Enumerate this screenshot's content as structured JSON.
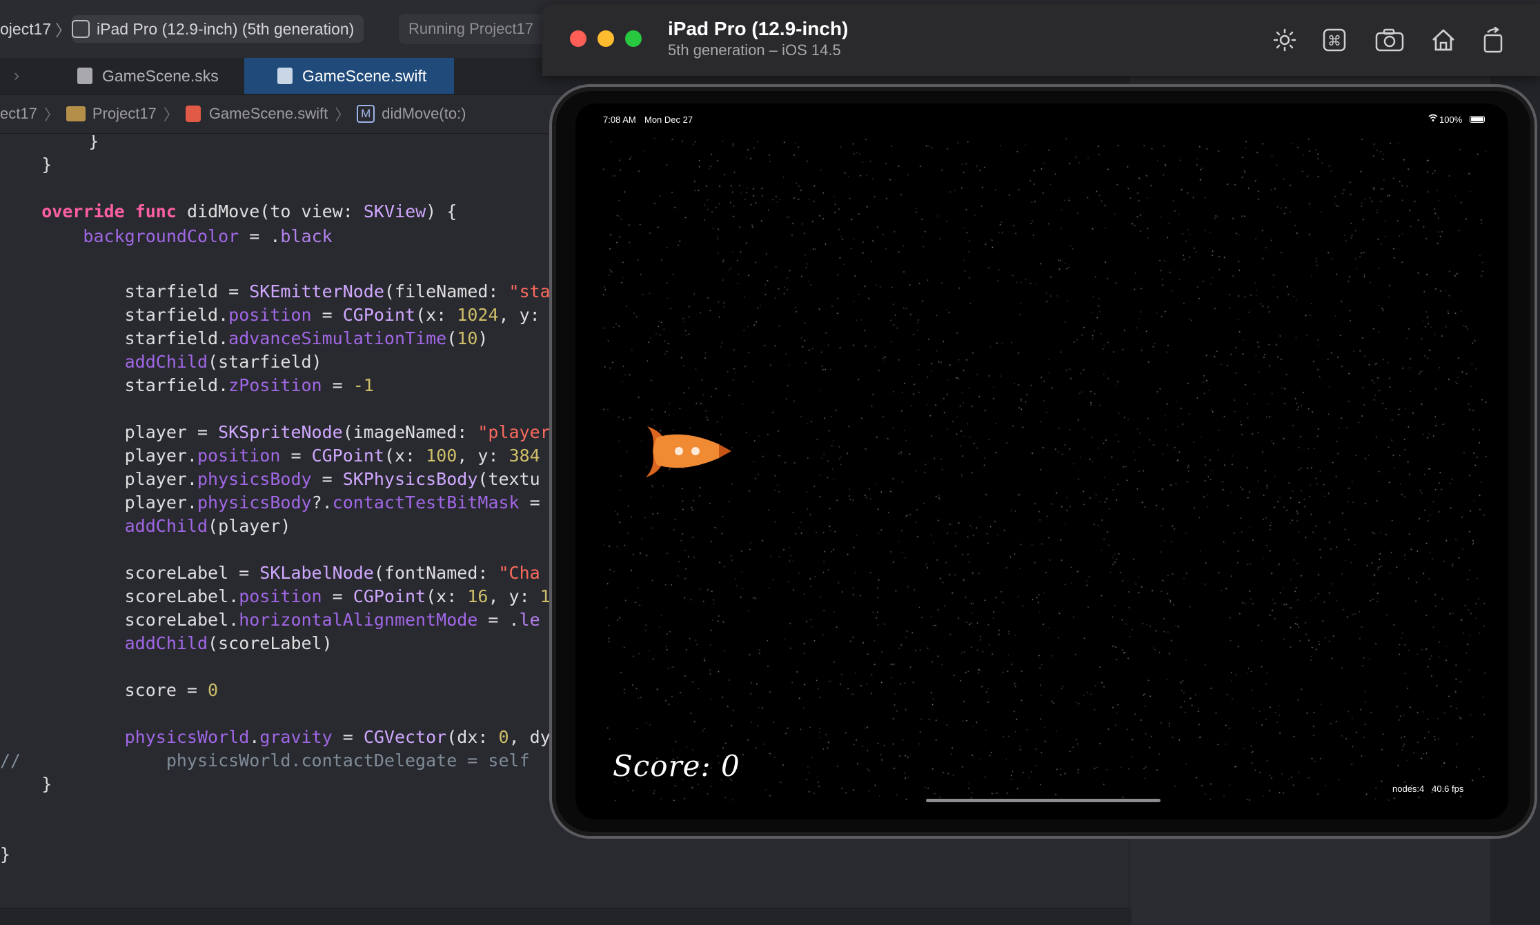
{
  "xcode": {
    "scheme_project": "oject17",
    "scheme_chevron": "〉",
    "scheme_device": "iPad Pro (12.9-inch) (5th generation)",
    "status": "Running Project17",
    "tabs": [
      {
        "label": "GameScene.sks",
        "icon": "sks-file-icon"
      },
      {
        "label": "GameScene.swift",
        "icon": "swift-file-icon"
      }
    ],
    "breadcrumbs": [
      "ect17",
      "Project17",
      "GameScene.swift",
      "didMove(to:)"
    ],
    "breadcrumb_method_badge": "M",
    "code_lines": [
      "    }",
      "    }",
      "",
      "    override func didMove(to view: SKView) {",
      "        backgroundColor = .black",
      "",
      "            starfield = SKEmitterNode(fileNamed: \"sta",
      "            starfield.position = CGPoint(x: 1024, y:",
      "            starfield.advanceSimulationTime(10)",
      "            addChild(starfield)",
      "            starfield.zPosition = -1",
      "",
      "            player = SKSpriteNode(imageNamed: \"player",
      "            player.position = CGPoint(x: 100, y: 384",
      "            player.physicsBody = SKPhysicsBody(textu",
      "            player.physicsBody?.contactTestBitMask =",
      "            addChild(player)",
      "",
      "            scoreLabel = SKLabelNode(fontNamed: \"Cha",
      "            scoreLabel.position = CGPoint(x: 16, y: 1",
      "            scoreLabel.horizontalAlignmentMode = .le",
      "            addChild(scoreLabel)",
      "",
      "            score = 0",
      "",
      "            physicsWorld.gravity = CGVector(dx: 0, dy",
      "//              physicsWorld.contactDelegate = self",
      "    }",
      "",
      "",
      "}"
    ]
  },
  "simulator": {
    "title": "iPad Pro (12.9-inch)",
    "subtitle": "5th generation – iOS 14.5",
    "toolbar": [
      "brightness-icon",
      "command-key-icon",
      "screenshot-camera-icon",
      "home-icon",
      "rotate-icon"
    ],
    "status_time": "7:08 AM",
    "status_date": "Mon Dec 27",
    "battery": "100%",
    "score_label": "Score: 0",
    "debug_nodes": "nodes:4",
    "debug_fps": "40.6 fps"
  },
  "colors": {
    "accent_tab": "#1f4a7a",
    "keyword": "#fc5fa3",
    "rocket": "#e8782a"
  }
}
